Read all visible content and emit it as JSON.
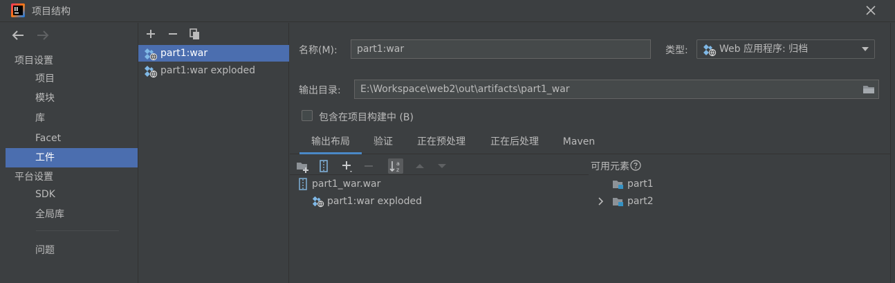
{
  "window": {
    "title": "项目结构"
  },
  "nav": {
    "back_icon": "arrow-left-icon",
    "forward_icon": "arrow-right-icon",
    "project_settings_header": "项目设置",
    "project_settings_items": [
      "项目",
      "模块",
      "库",
      "Facet",
      "工件"
    ],
    "selected_item": "工件",
    "platform_settings_header": "平台设置",
    "platform_settings_items": [
      "SDK",
      "全局库"
    ],
    "problems": "问题"
  },
  "artifacts": {
    "toolbar": [
      "add-icon",
      "remove-icon",
      "copy-icon"
    ],
    "items": [
      "part1:war",
      "part1:war exploded"
    ],
    "selected": "part1:war"
  },
  "form": {
    "name_label": "名称(M):",
    "name_value": "part1:war",
    "type_label": "类型:",
    "type_value": "Web 应用程序: 归档",
    "output_label": "输出目录:",
    "output_value": "E:\\Workspace\\web2\\out\\artifacts\\part1_war",
    "include_label": "包含在项目构建中 (B)",
    "include_checked": false
  },
  "tabs": {
    "items": [
      "输出布局",
      "验证",
      "正在预处理",
      "正在后处理",
      "Maven"
    ],
    "selected": "输出布局"
  },
  "layout": {
    "tree": [
      {
        "label": "part1_war.war",
        "icon": "war-archive-icon"
      },
      {
        "label": "part1:war exploded",
        "icon": "artifact-icon"
      }
    ]
  },
  "available": {
    "label": "可用元素",
    "items": [
      {
        "label": "part1",
        "icon": "module-folder-icon",
        "expandable": false
      },
      {
        "label": "part2",
        "icon": "module-folder-icon",
        "expandable": true
      }
    ]
  },
  "colors": {
    "background": "#3c3f41",
    "selection": "#4b6eaf",
    "tab_underline": "#4a88c7",
    "field_background": "#45494a",
    "text": "#bbbbbb"
  }
}
